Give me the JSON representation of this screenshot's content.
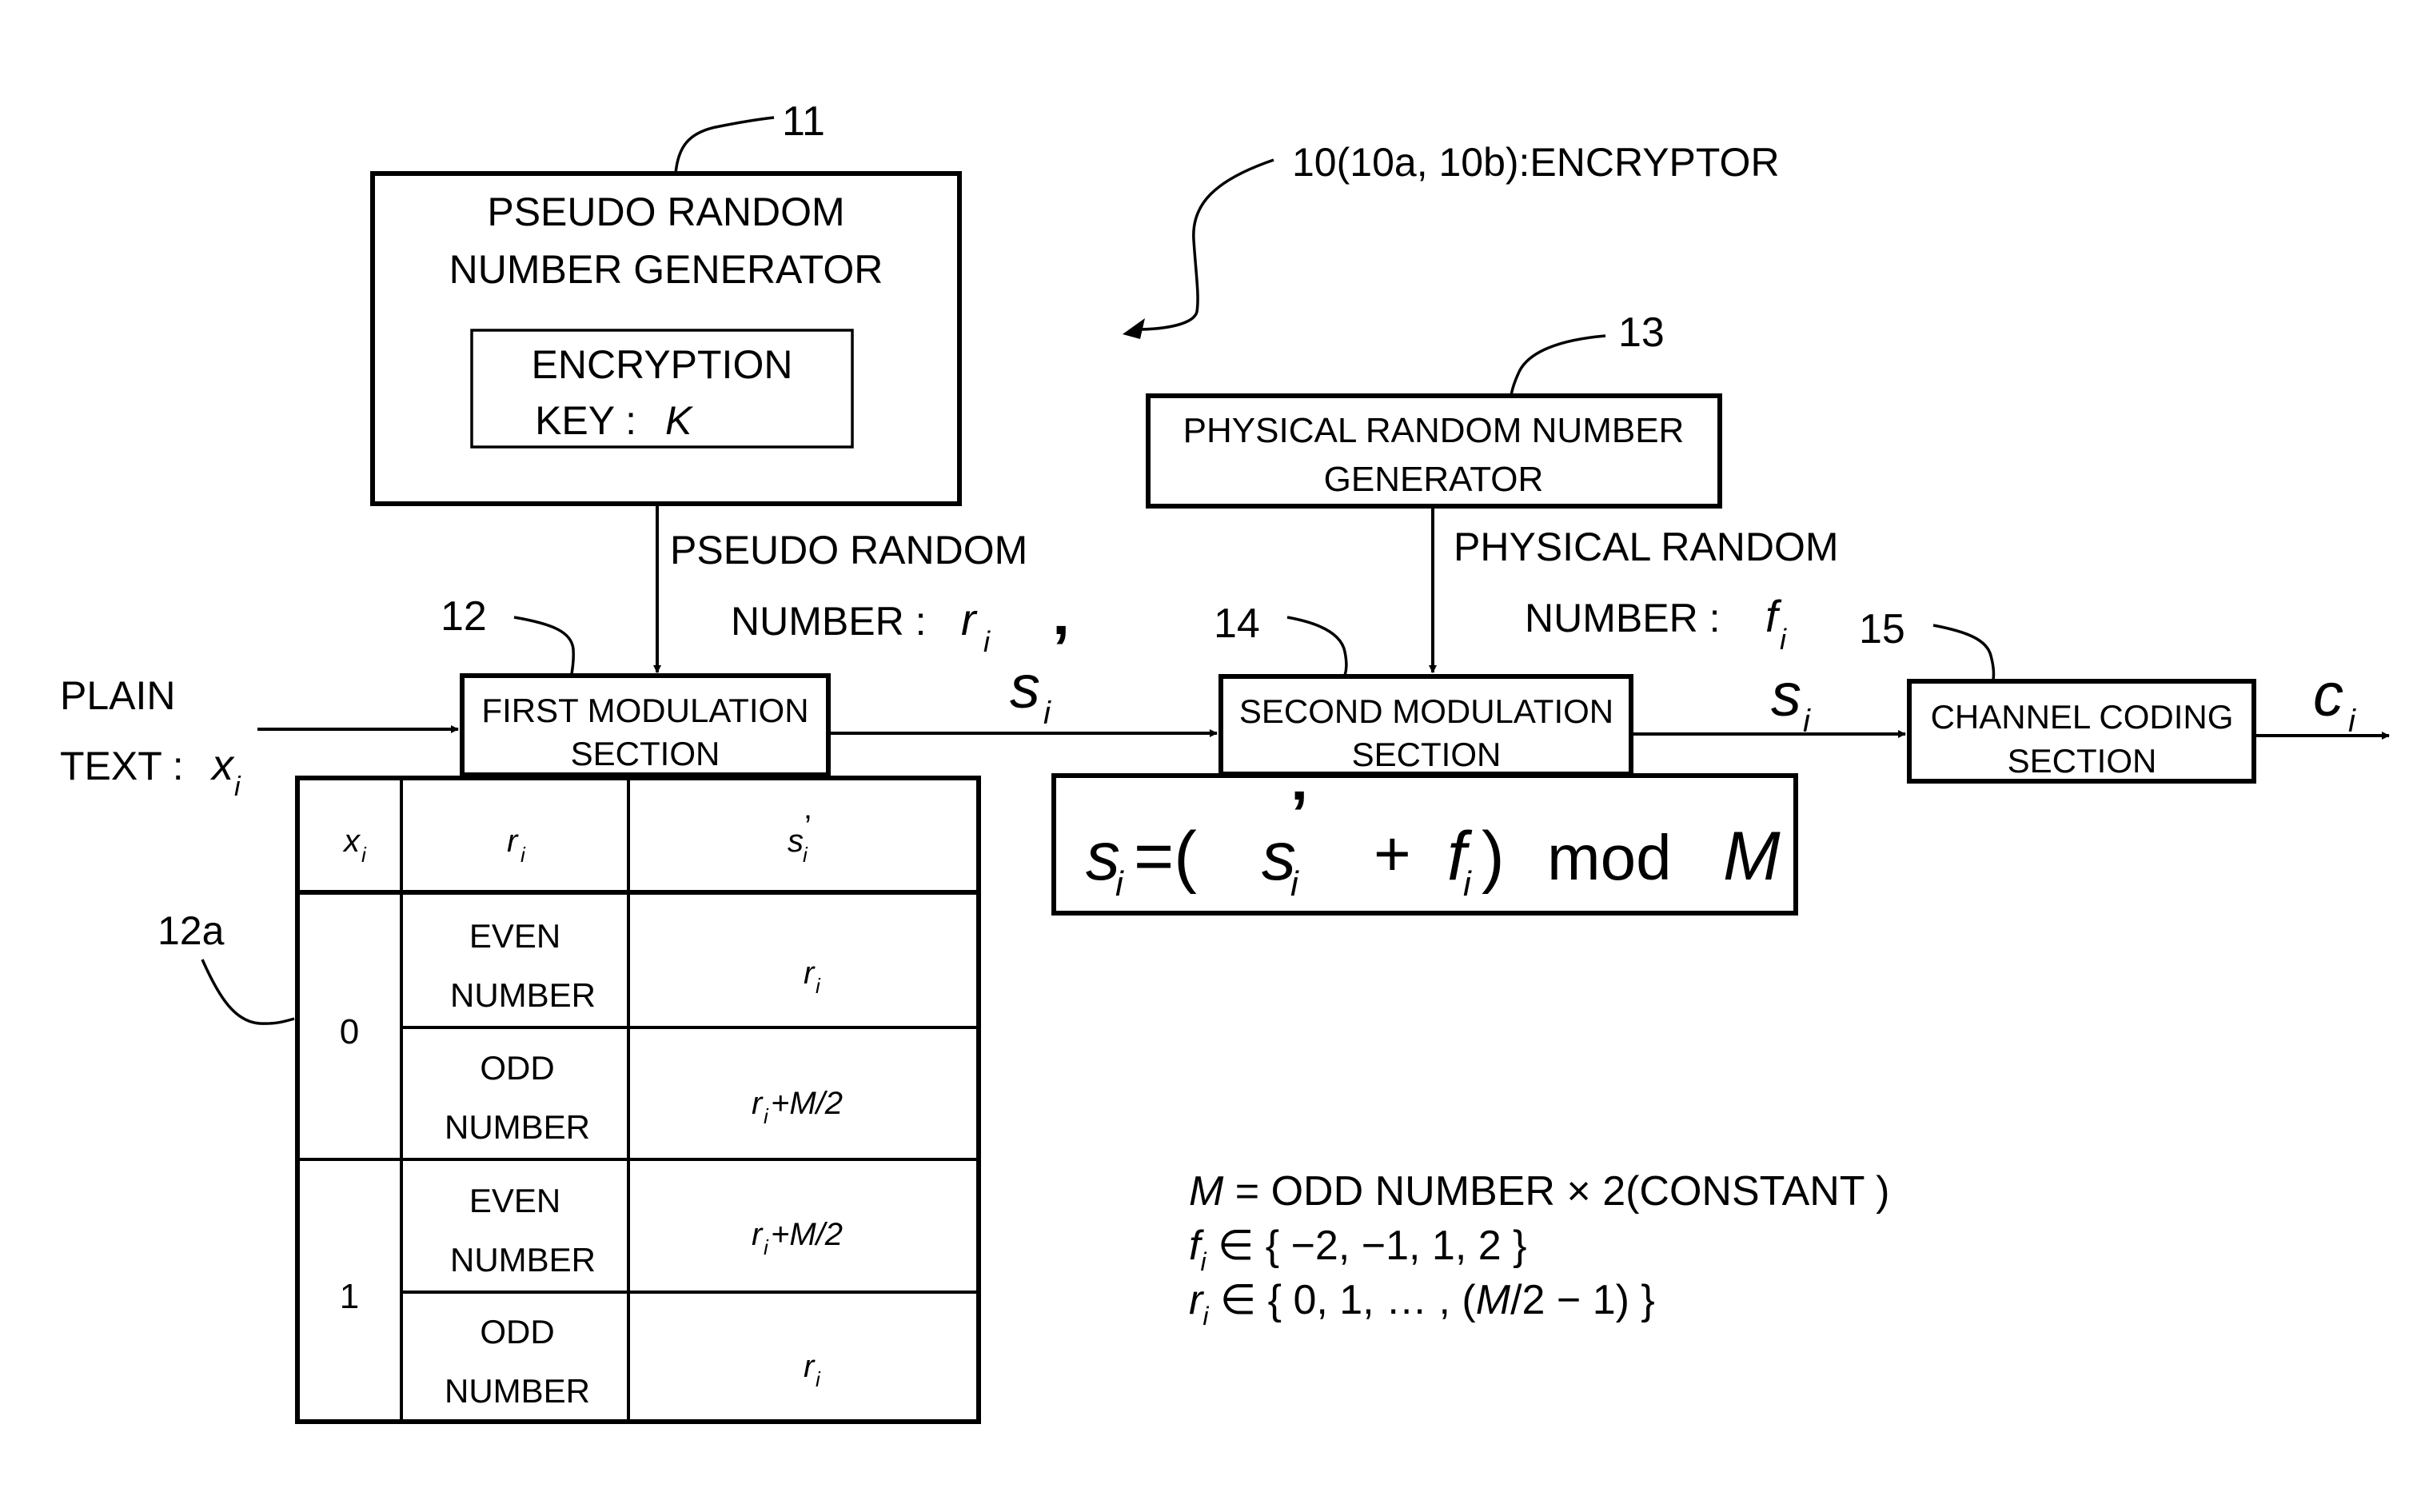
{
  "figure": {
    "encryptor_label": "10(10a, 10b):ENCRYPTOR",
    "colors": {
      "ink": "#000000",
      "paper": "#ffffff"
    }
  },
  "refs": {
    "prng": "11",
    "first_mod": "12",
    "table": "12a",
    "physical_rng": "13",
    "second_mod": "14",
    "channel": "15"
  },
  "blocks": {
    "prng": {
      "line1": "PSEUDO RANDOM",
      "line2": "NUMBER GENERATOR"
    },
    "key": {
      "line1": "ENCRYPTION",
      "line2_prefix": "KEY :",
      "symbol": "K"
    },
    "physical_rng": {
      "line1": "PHYSICAL RANDOM NUMBER",
      "line2": "GENERATOR"
    },
    "first_mod": {
      "line1": "FIRST MODULATION",
      "line2": "SECTION"
    },
    "second_mod": {
      "line1": "SECOND MODULATION",
      "line2": "SECTION"
    },
    "channel": {
      "line1": "CHANNEL CODING",
      "line2": "SECTION"
    }
  },
  "signals": {
    "plain_line1": "PLAIN",
    "plain_line2_prefix": "TEXT :",
    "plain_symbol": "x",
    "pseudo_line1": "PSEUDO RANDOM",
    "pseudo_line2_prefix": "NUMBER :",
    "pseudo_symbol": "r",
    "physical_line1": "PHYSICAL RANDOM",
    "physical_line2_prefix": "NUMBER :",
    "physical_symbol": "f",
    "s_prime": "s",
    "s": "s",
    "c": "c",
    "subscript": "i",
    "prime": "’"
  },
  "formula": {
    "lhs": "s",
    "eq": "=(",
    "s_prime": "s",
    "plus": "+",
    "f": "f",
    "rparen": ")",
    "mod": "mod",
    "M": "M"
  },
  "table": {
    "headers": [
      "x",
      "r",
      "s"
    ],
    "header_subscript": "i",
    "groups": [
      {
        "x": "0",
        "rows": [
          {
            "r1": "EVEN",
            "r2": "NUMBER",
            "s": "r",
            "s_suffix": ""
          },
          {
            "r1": "ODD",
            "r2": "NUMBER",
            "s": "r",
            "s_suffix": "+M/2"
          }
        ]
      },
      {
        "x": "1",
        "rows": [
          {
            "r1": "EVEN",
            "r2": "NUMBER",
            "s": "r",
            "s_suffix": "+M/2"
          },
          {
            "r1": "ODD",
            "r2": "NUMBER",
            "s": "r",
            "s_suffix": ""
          }
        ]
      }
    ]
  },
  "notes": {
    "line1_M": "M",
    "line1_rest": " = ODD NUMBER  × 2(CONSTANT )",
    "line2_f": "f",
    "line2_rest": " ∈ { −2, −1, 1, 2 }",
    "line3_r": "r",
    "line3_rest_a": " ∈ { 0, 1, … , (",
    "line3_M": "M",
    "line3_rest_b": "/2 − 1) }"
  }
}
